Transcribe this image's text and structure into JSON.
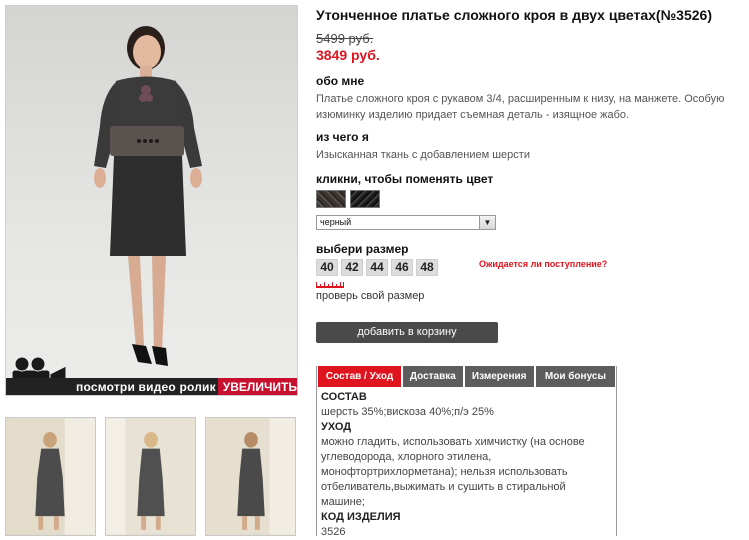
{
  "product": {
    "title": "Утонченное платье сложного кроя в двух цветах(№3526)",
    "old_price": "5499 руб.",
    "new_price": "3849 руб."
  },
  "about": {
    "heading": "обо мне",
    "text": "Платье сложного кроя с рукавом 3/4, расширенным к низу, на манжете. Особую изюминку изделию придает съемная деталь - изящное жабо."
  },
  "material": {
    "heading": "из чего я",
    "text": "Изысканная ткань с добавлением шерсти"
  },
  "color": {
    "heading": "кликни, чтобы поменять цвет",
    "selected": "черный",
    "swatches": [
      "dark-brown-tweed",
      "black-tweed"
    ]
  },
  "size": {
    "heading": "выбери размер",
    "options": [
      "40",
      "42",
      "44",
      "46",
      "48"
    ],
    "notify_link": "Ожидается ли поступление?",
    "check_link": "проверь свой размер"
  },
  "cart": {
    "button_label": "добавить в корзину"
  },
  "photo": {
    "watch_video": "посмотри видео ролик",
    "zoom": "УВЕЛИЧИТЬ"
  },
  "tabs": {
    "items": [
      "Состав / Уход",
      "Доставка",
      "Измерения",
      "Мои бонусы"
    ],
    "active": 0,
    "content": {
      "composition_heading": "СОСТАВ",
      "composition": "шерсть 35%;вискоза 40%;п/э 25%",
      "care_heading": "УХОД",
      "care": "можно гладить, использовать химчистку (на основе углеводорода, хлорного этилена, монофтортрихлорметана); нельзя использовать отбеливатель,выжимать и сушить в стиральной машине;",
      "code_heading": "КОД ИЗДЕЛИЯ",
      "code": "3526"
    }
  },
  "colors": {
    "accent": "#e0141e",
    "tab_inactive": "#5d5d5d",
    "button": "#4a4a4a"
  }
}
